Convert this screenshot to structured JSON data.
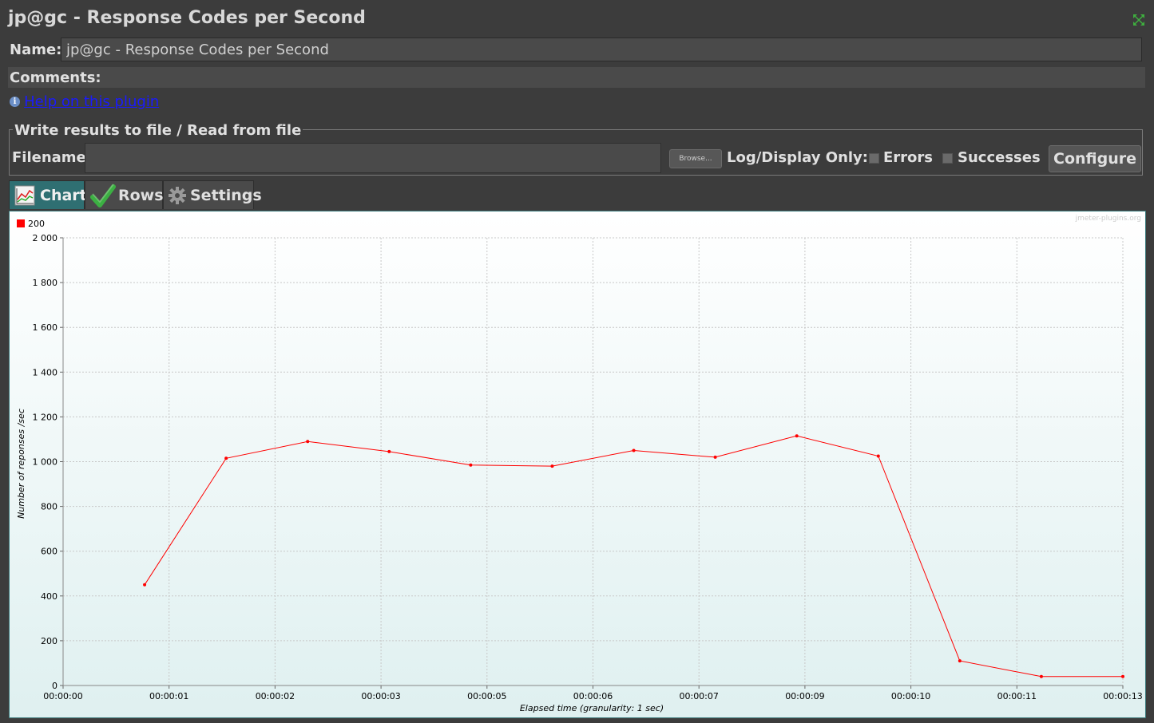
{
  "window": {
    "title": "jp@gc - Response Codes per Second"
  },
  "form": {
    "name_label": "Name:",
    "name_value": "jp@gc - Response Codes per Second",
    "comments_label": "Comments:",
    "help_link": "Help on this plugin"
  },
  "file_section": {
    "legend": "Write results to file / Read from file",
    "filename_label": "Filename",
    "filename_value": "",
    "browse_label": "Browse...",
    "log_display_label": "Log/Display Only:",
    "errors_label": "Errors",
    "successes_label": "Successes",
    "configure_label": "Configure"
  },
  "tabs": [
    {
      "label": "Chart",
      "icon": "chart-icon",
      "active": true
    },
    {
      "label": "Rows",
      "icon": "checkmark-icon",
      "active": false
    },
    {
      "label": "Settings",
      "icon": "gear-icon",
      "active": false
    }
  ],
  "chart_data": {
    "type": "line",
    "watermark": "jmeter-plugins.org",
    "xlabel": "Elapsed time (granularity: 1 sec)",
    "ylabel": "Number of reponses /sec",
    "ylim": [
      0,
      2000
    ],
    "y_ticks": [
      "0",
      "200",
      "400",
      "600",
      "800",
      "1 000",
      "1 200",
      "1 400",
      "1 600",
      "1 800",
      "2 000"
    ],
    "x_ticks": [
      "00:00:00",
      "00:00:01",
      "00:00:02",
      "00:00:03",
      "00:00:05",
      "00:00:06",
      "00:00:07",
      "00:00:09",
      "00:00:10",
      "00:00:11",
      "00:00:13"
    ],
    "x_range_seconds": [
      0,
      13
    ],
    "grid": true,
    "legend_position": "top-left",
    "series": [
      {
        "name": "200",
        "color": "#ff0000",
        "x": [
          1.0,
          2.0,
          3.0,
          4.0,
          5.0,
          6.0,
          7.0,
          8.0,
          9.0,
          10.0,
          11.0,
          12.0,
          13.0
        ],
        "values": [
          450,
          1015,
          1090,
          1045,
          985,
          980,
          1050,
          1020,
          1115,
          1025,
          110,
          40,
          40
        ]
      }
    ]
  }
}
